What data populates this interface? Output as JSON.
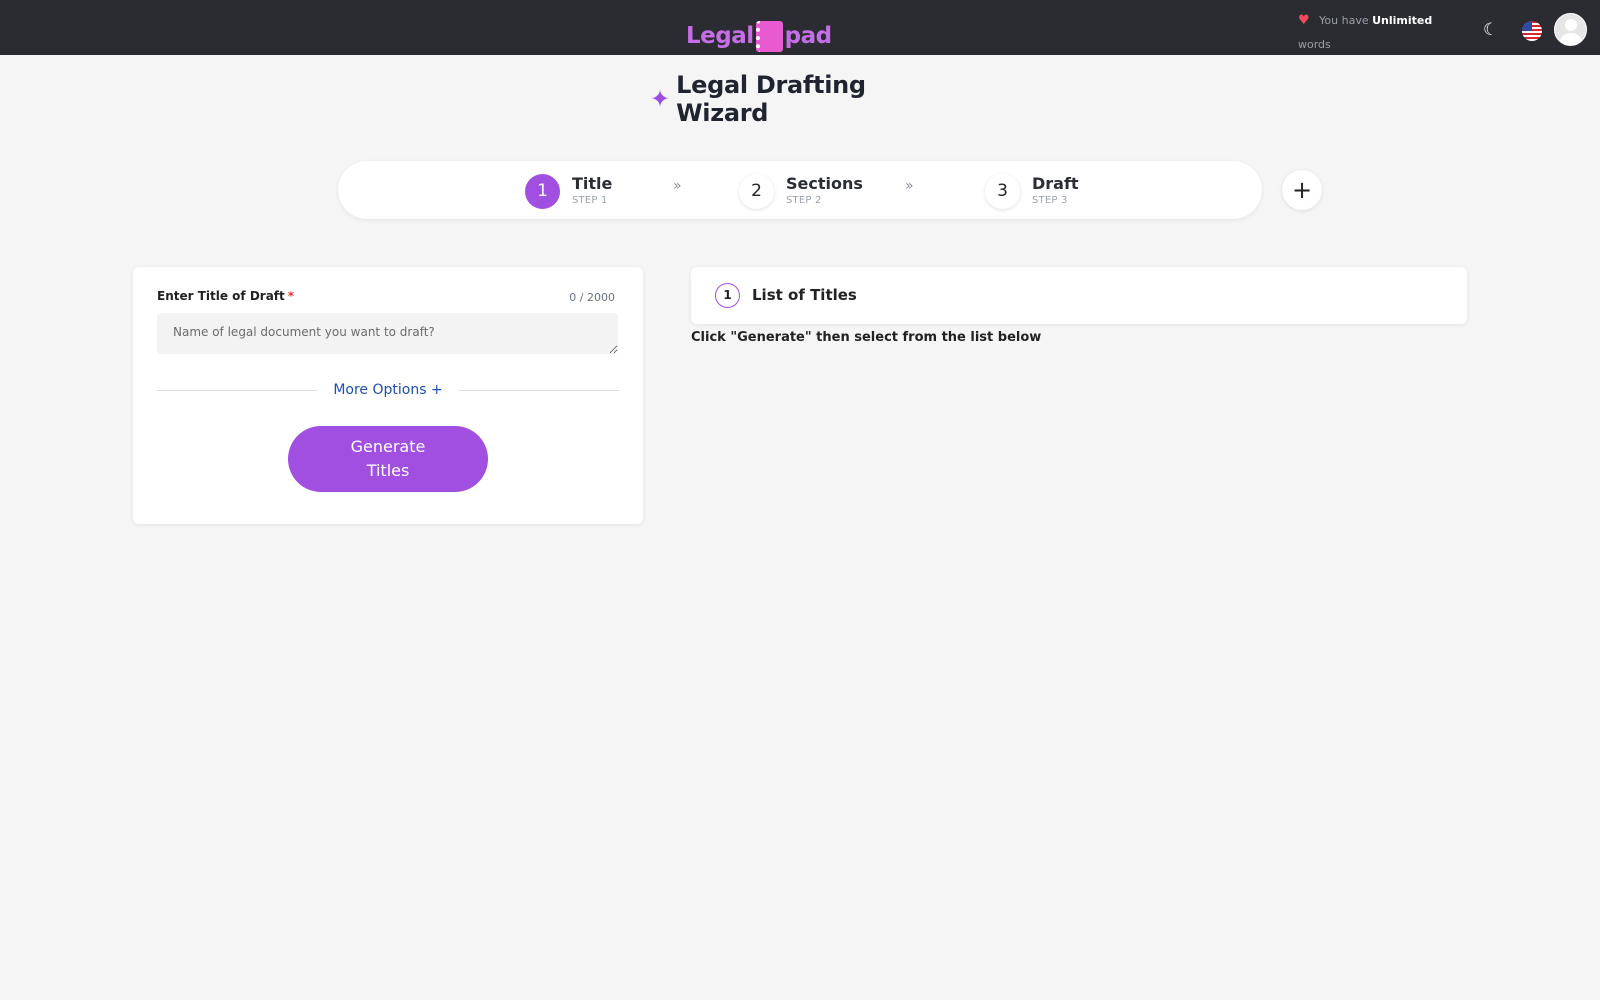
{
  "header": {
    "logo_left": "Legal",
    "logo_right": "pad",
    "words_prefix": "You have",
    "words_value": "Unlimited",
    "words_suffix": "words"
  },
  "page": {
    "title": "Legal Drafting Wizard"
  },
  "stepper": {
    "steps": [
      {
        "number": "1",
        "name": "Title",
        "sub": "STEP 1",
        "active": true
      },
      {
        "number": "2",
        "name": "Sections",
        "sub": "STEP 2",
        "active": false
      },
      {
        "number": "3",
        "name": "Draft",
        "sub": "STEP 3",
        "active": false
      }
    ],
    "add_label": "+"
  },
  "title_form": {
    "label": "Enter Title of Draft",
    "required_mark": "*",
    "char_count": "0 / 2000",
    "placeholder": "Name of legal document you want to draft?",
    "more_options": "More Options +",
    "generate_label": "Generate Titles"
  },
  "titles_panel": {
    "badge": "1",
    "title": "List of Titles",
    "hint": "Click \"Generate\" then select from the list below"
  },
  "colors": {
    "accent": "#a14fe0",
    "header_bg": "#2b2c31",
    "link": "#1d4fb0"
  }
}
